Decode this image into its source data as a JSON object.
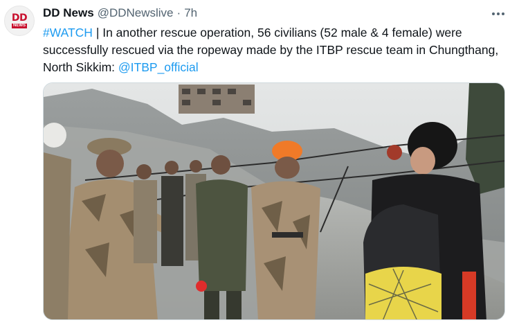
{
  "tweet": {
    "author_name": "DD News",
    "author_handle": "@DDNewslive",
    "separator": "·",
    "time": "7h",
    "avatar": {
      "logo_top": "DD",
      "logo_bottom": "NEWS",
      "brand_color": "#c8102e"
    },
    "text": {
      "hashtag": "#WATCH",
      "body": " | In another rescue operation, 56 civilians (52 male & 4 female) were successfully rescued via the ropeway made by the ITBP rescue team in Chungthang, North Sikkim: ",
      "mention": "@ITBP_official"
    },
    "more_icon": "more-horizontal-icon",
    "link_color": "#1d9bf0"
  }
}
